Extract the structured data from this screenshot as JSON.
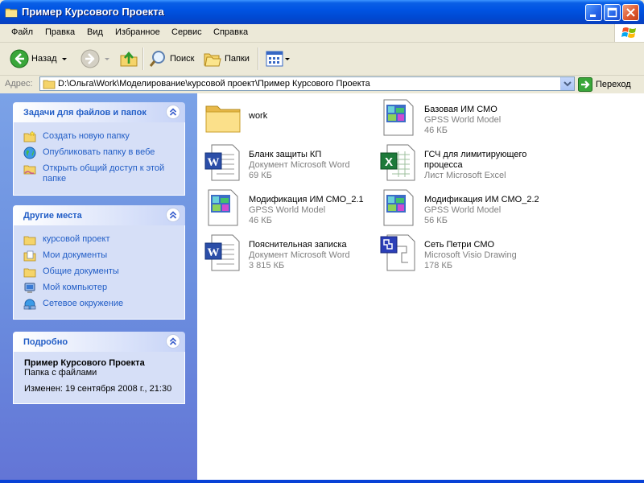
{
  "window": {
    "title": "Пример Курсового Проекта"
  },
  "menu": [
    "Файл",
    "Правка",
    "Вид",
    "Избранное",
    "Сервис",
    "Справка"
  ],
  "toolbar": {
    "back": "Назад",
    "search": "Поиск",
    "folders": "Папки"
  },
  "address": {
    "label": "Адрес:",
    "path": "D:\\Ольга\\Work\\Моделирование\\курсовой проект\\Пример Курсового Проекта",
    "go": "Переход"
  },
  "panels": {
    "tasks": {
      "title": "Задачи для файлов и папок",
      "items": [
        "Создать новую папку",
        "Опубликовать папку в вебе",
        "Открыть общий доступ к этой папке"
      ]
    },
    "places": {
      "title": "Другие места",
      "items": [
        "курсовой проект",
        "Мои документы",
        "Общие документы",
        "Мой компьютер",
        "Сетевое окружение"
      ]
    },
    "details": {
      "title": "Подробно",
      "name": "Пример Курсового Проекта",
      "type": "Папка с файлами",
      "modified": "Изменен: 19 сентября 2008 г., 21:30"
    }
  },
  "files": [
    {
      "name": "work",
      "type": "",
      "size": "",
      "icon": "folder-icon"
    },
    {
      "name": "Базовая ИМ СМО",
      "type": "GPSS World Model",
      "size": "46 КБ",
      "icon": "gpss-icon"
    },
    {
      "name": "Бланк защиты КП",
      "type": "Документ Microsoft Word",
      "size": "69 КБ",
      "icon": "word-icon"
    },
    {
      "name": "ГСЧ для лимитирующего процесса",
      "type": "Лист Microsoft Excel",
      "size": "",
      "icon": "excel-icon"
    },
    {
      "name": "Модификация ИМ СМО_2.1",
      "type": "GPSS World Model",
      "size": "46 КБ",
      "icon": "gpss-icon"
    },
    {
      "name": "Модификация ИМ СМО_2.2",
      "type": "GPSS World Model",
      "size": "56 КБ",
      "icon": "gpss-icon"
    },
    {
      "name": "Пояснительная записка",
      "type": "Документ Microsoft Word",
      "size": "3 815 КБ",
      "icon": "word-icon"
    },
    {
      "name": "Сеть Петри СМО",
      "type": "Microsoft Visio Drawing",
      "size": "178 КБ",
      "icon": "visio-icon"
    }
  ],
  "colors": {
    "titlebar": "#0054e3",
    "link": "#215dc6",
    "sidebar": "#6b8fdf"
  }
}
